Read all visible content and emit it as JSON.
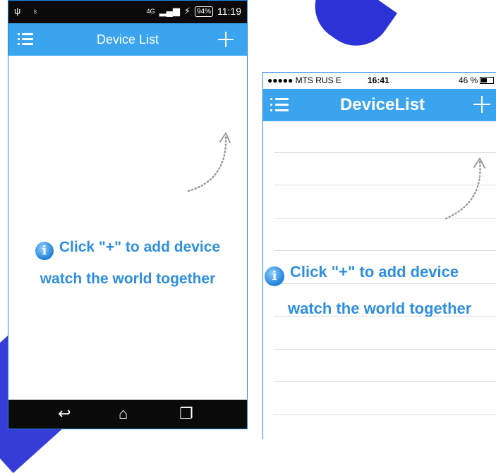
{
  "android": {
    "status": {
      "time": "11:19",
      "battery": "94%",
      "network": "4G"
    },
    "header": {
      "title": "Device List",
      "menu_icon": "menu-icon",
      "add_icon": "plus-icon"
    },
    "hint": {
      "line1": "Click \"+\" to add device",
      "line2": "watch the world together"
    },
    "nav": {
      "back": "back-icon",
      "home": "home-icon",
      "recent": "recent-apps-icon"
    }
  },
  "ios": {
    "status": {
      "carrier": "●●●●● MTS RUS  E",
      "time": "16:41",
      "battery": "46 %"
    },
    "header": {
      "title": "DeviceList",
      "menu_icon": "menu-icon",
      "add_icon": "plus-icon"
    },
    "hint": {
      "line1": "Click \"+\" to add device",
      "line2": "watch the world together"
    }
  },
  "colors": {
    "bar": "#3aa5ee",
    "hint_text": "#2e8fe0",
    "border": "#1e88e5",
    "watermark": "#2b32d6"
  }
}
